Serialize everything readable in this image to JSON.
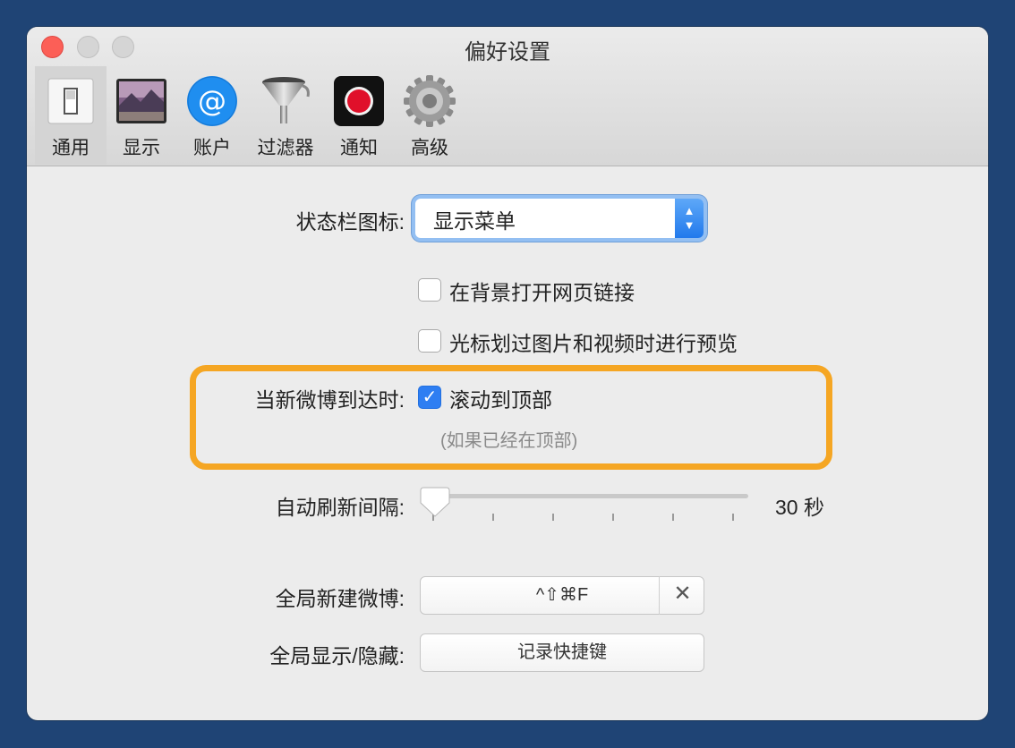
{
  "window": {
    "title": "偏好设置"
  },
  "toolbar": {
    "tabs": [
      {
        "label": "通用",
        "icon": "switch-icon",
        "active": true
      },
      {
        "label": "显示",
        "icon": "landscape-image-icon",
        "active": false
      },
      {
        "label": "账户",
        "icon": "at-sign-icon",
        "active": false
      },
      {
        "label": "过滤器",
        "icon": "funnel-icon",
        "active": false
      },
      {
        "label": "通知",
        "icon": "record-icon",
        "active": false
      },
      {
        "label": "高级",
        "icon": "gear-icon",
        "active": false
      }
    ]
  },
  "general": {
    "status_icon": {
      "label": "状态栏图标:",
      "value": "显示菜单"
    },
    "open_in_background": {
      "label": "在背景打开网页链接",
      "checked": false
    },
    "hover_preview": {
      "label": "光标划过图片和视频时进行预览",
      "checked": false
    },
    "new_weibo": {
      "label": "当新微博到达时:",
      "option": "滚动到顶部",
      "checked": true,
      "hint": "(如果已经在顶部)"
    },
    "refresh_interval": {
      "label": "自动刷新间隔:",
      "value_text": "30 秒",
      "level": 0
    },
    "global_new_weibo": {
      "label": "全局新建微博:",
      "shortcut": "^⇧⌘F",
      "clear": "✕"
    },
    "global_show_hide": {
      "label": "全局显示/隐藏:",
      "button": "记录快捷键"
    }
  },
  "colors": {
    "highlight": "#f5a623",
    "accent": "#2e7ef2",
    "background": "#1f4475"
  }
}
